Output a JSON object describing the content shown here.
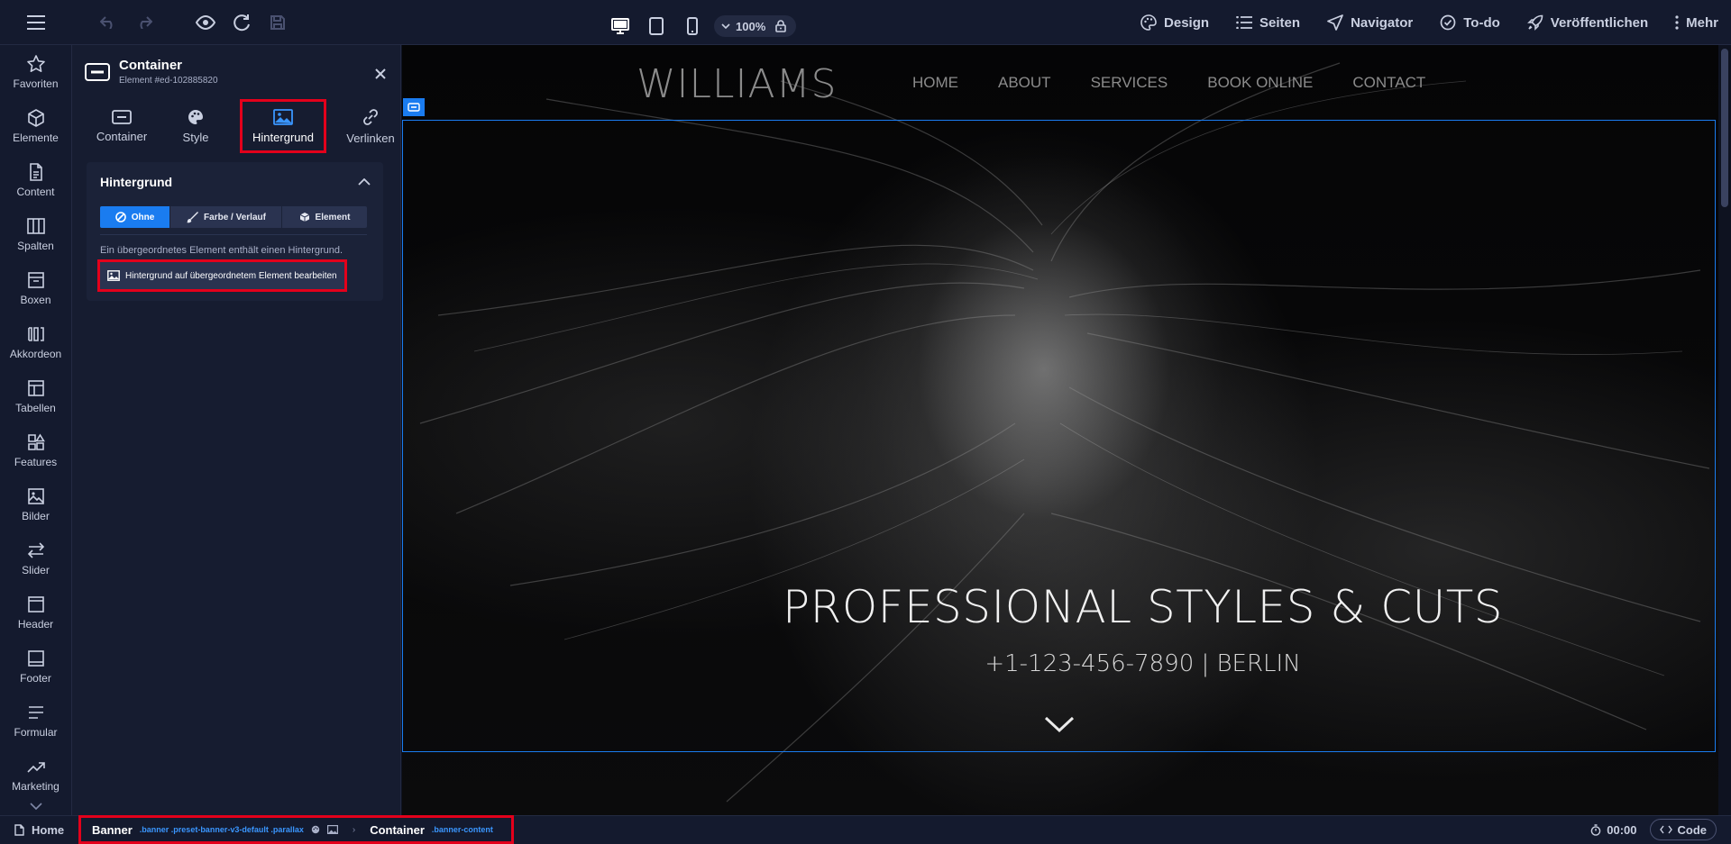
{
  "topbar": {
    "zoom": "100%",
    "links": [
      {
        "label": "Design",
        "icon": "palette-icon"
      },
      {
        "label": "Seiten",
        "icon": "list-icon"
      },
      {
        "label": "Navigator",
        "icon": "navigator-icon"
      },
      {
        "label": "To-do",
        "icon": "check-circle-icon"
      },
      {
        "label": "Veröffentlichen",
        "icon": "rocket-icon"
      },
      {
        "label": "Mehr",
        "icon": "more-vertical-icon"
      }
    ]
  },
  "rail": {
    "items": [
      {
        "label": "Favoriten"
      },
      {
        "label": "Elemente"
      },
      {
        "label": "Content"
      },
      {
        "label": "Spalten"
      },
      {
        "label": "Boxen"
      },
      {
        "label": "Akkordeon"
      },
      {
        "label": "Tabellen"
      },
      {
        "label": "Features"
      },
      {
        "label": "Bilder"
      },
      {
        "label": "Slider"
      },
      {
        "label": "Header"
      },
      {
        "label": "Footer"
      },
      {
        "label": "Formular"
      },
      {
        "label": "Marketing"
      }
    ]
  },
  "panel": {
    "title": "Container",
    "subtitle": "Element #ed-102885820",
    "tabs": [
      {
        "label": "Container"
      },
      {
        "label": "Style"
      },
      {
        "label": "Hintergrund"
      },
      {
        "label": "Verlinken"
      }
    ],
    "section": {
      "title": "Hintergrund",
      "options": [
        {
          "label": "Ohne"
        },
        {
          "label": "Farbe / Verlauf"
        },
        {
          "label": "Element"
        }
      ],
      "info": "Ein übergeordnetes Element enthält einen Hintergrund.",
      "edit_button": "Hintergrund auf übergeordnetem Element bearbeiten"
    }
  },
  "site": {
    "logo": "WILLIAMS",
    "nav": [
      "HOME",
      "ABOUT",
      "SERVICES",
      "BOOK ONLINE",
      "CONTACT"
    ],
    "hero_title": "PROFESSIONAL STYLES & CUTS",
    "hero_subtitle": "+1-123-456-7890 | BERLIN"
  },
  "statusbar": {
    "home": "Home",
    "crumbs": [
      {
        "name": "Banner",
        "classes": ".banner .preset-banner-v3-default .parallax"
      },
      {
        "name": "Container",
        "classes": ".banner-content"
      }
    ],
    "timer": "00:00",
    "code": "Code"
  },
  "colors": {
    "accent": "#1a7cf0",
    "highlight": "#e3001b",
    "panel": "#161c30"
  }
}
